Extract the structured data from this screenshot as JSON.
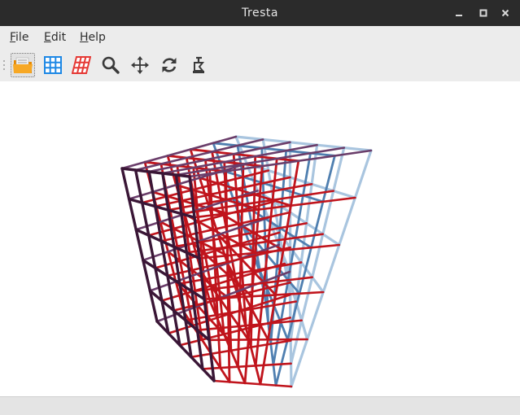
{
  "window": {
    "title": "Tresta"
  },
  "menu": [
    {
      "label": "File",
      "mnemonic": "F",
      "rest": "ile"
    },
    {
      "label": "Edit",
      "mnemonic": "E",
      "rest": "dit"
    },
    {
      "label": "Help",
      "mnemonic": "H",
      "rest": "elp"
    }
  ],
  "toolbar": {
    "buttons": [
      {
        "icon": "open-folder-icon",
        "active": true
      },
      {
        "icon": "blue-grid-icon"
      },
      {
        "icon": "red-grid-icon"
      },
      {
        "icon": "zoom-icon"
      },
      {
        "icon": "move-icon"
      },
      {
        "icon": "rotate-icon"
      },
      {
        "icon": "reset-view-icon"
      }
    ]
  },
  "viewport": {
    "content": "3d-wireframe-cube",
    "grid_divisions": 5,
    "colors": {
      "front": "#3a1636",
      "inner": "#c0141c",
      "back": "#4f7fb0",
      "back_light": "#a9c5df"
    }
  },
  "status": {
    "text": ""
  }
}
